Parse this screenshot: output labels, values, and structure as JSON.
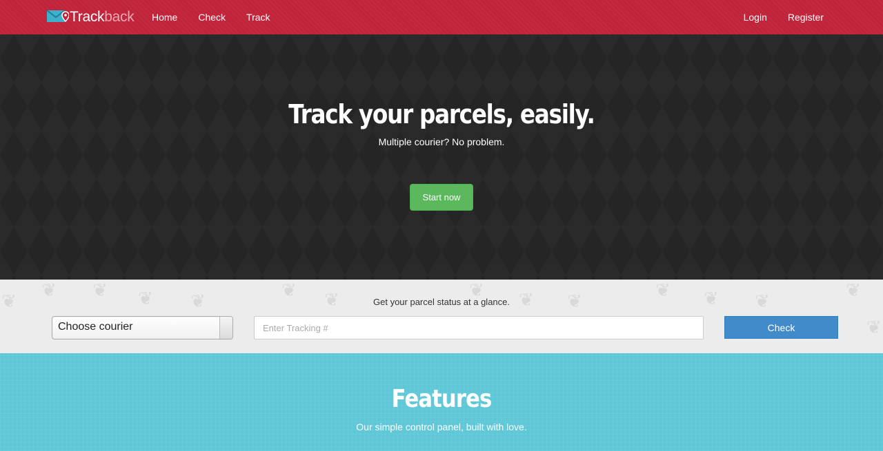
{
  "brand": {
    "part1": "Track",
    "part2": "back",
    "icon": "envelope-pin-icon"
  },
  "nav": {
    "left": [
      "Home",
      "Check",
      "Track"
    ],
    "right": [
      "Login",
      "Register"
    ]
  },
  "hero": {
    "title": "Track your parcels, easily.",
    "subtitle": "Multiple courier? No problem.",
    "cta": "Start now"
  },
  "check": {
    "label": "Get your parcel status at a glance.",
    "courier_selected": "Choose courier",
    "tracking_placeholder": "Enter Tracking #",
    "tracking_value": "",
    "button": "Check"
  },
  "features": {
    "title": "Features",
    "subtitle": "Our simple control panel, built with love."
  },
  "colors": {
    "navbar": "#c0233a",
    "hero_bg": "#252525",
    "cta_green": "#5cb85c",
    "check_blue": "#428bca",
    "features_bg": "#5ec8d8"
  }
}
